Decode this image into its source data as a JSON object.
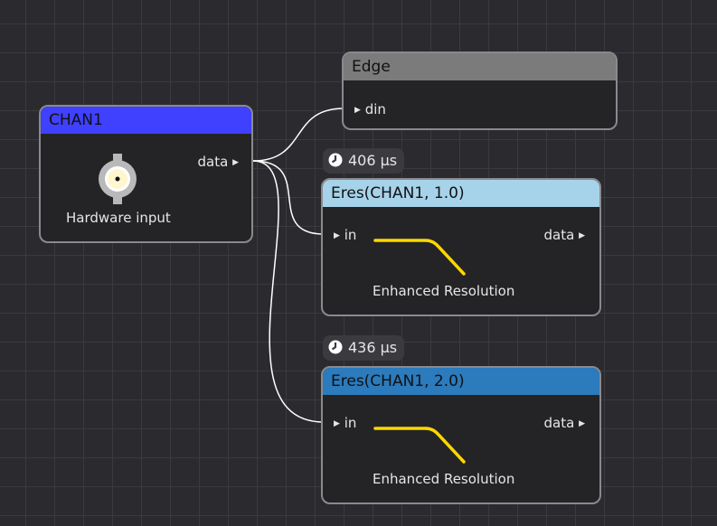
{
  "nodes": {
    "chan1": {
      "title": "CHAN1",
      "header_color": "#4040ff",
      "output_port": "data",
      "caption": "Hardware input",
      "icon": "bnc-connector-icon"
    },
    "edge": {
      "title": "Edge",
      "header_color": "#7b7b7b",
      "input_port": "din"
    },
    "eres1": {
      "title": "Eres(CHAN1, 1.0)",
      "header_color": "#a7d3ea",
      "input_port": "in",
      "output_port": "data",
      "caption": "Enhanced Resolution",
      "timing": "406 µs",
      "icon": "lowpass-filter-icon"
    },
    "eres2": {
      "title": "Eres(CHAN1, 2.0)",
      "header_color": "#2b7bbd",
      "input_port": "in",
      "output_port": "data",
      "caption": "Enhanced Resolution",
      "timing": "436 µs",
      "icon": "lowpass-filter-icon"
    }
  },
  "colors": {
    "canvas_background": "#2b2b2f",
    "grid_line": "#3a3a3f",
    "node_body": "#242427",
    "node_border": "#8a8a8e",
    "wire": "#ffffff",
    "filter_curve": "#ffd800"
  }
}
